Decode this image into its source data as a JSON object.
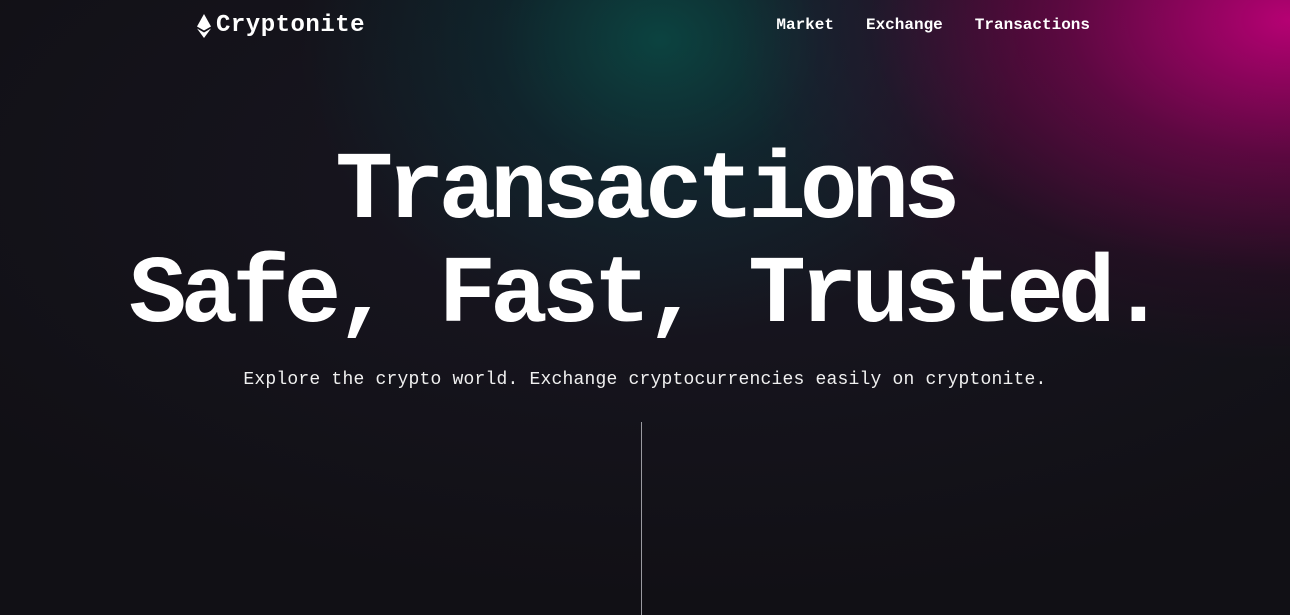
{
  "brand": {
    "name": "Cryptonite",
    "icon": "ethereum-icon"
  },
  "nav": {
    "links": [
      {
        "label": "Market"
      },
      {
        "label": "Exchange"
      },
      {
        "label": "Transactions"
      }
    ]
  },
  "hero": {
    "title_line1": "Transactions",
    "title_line2": "Safe, Fast, Trusted.",
    "subtitle": "Explore the crypto world. Exchange cryptocurrencies easily on cryptonite."
  },
  "colors": {
    "background": "#111015",
    "accent_magenta": "#b0006e",
    "accent_teal": "#0a4b46",
    "text": "#ffffff"
  }
}
